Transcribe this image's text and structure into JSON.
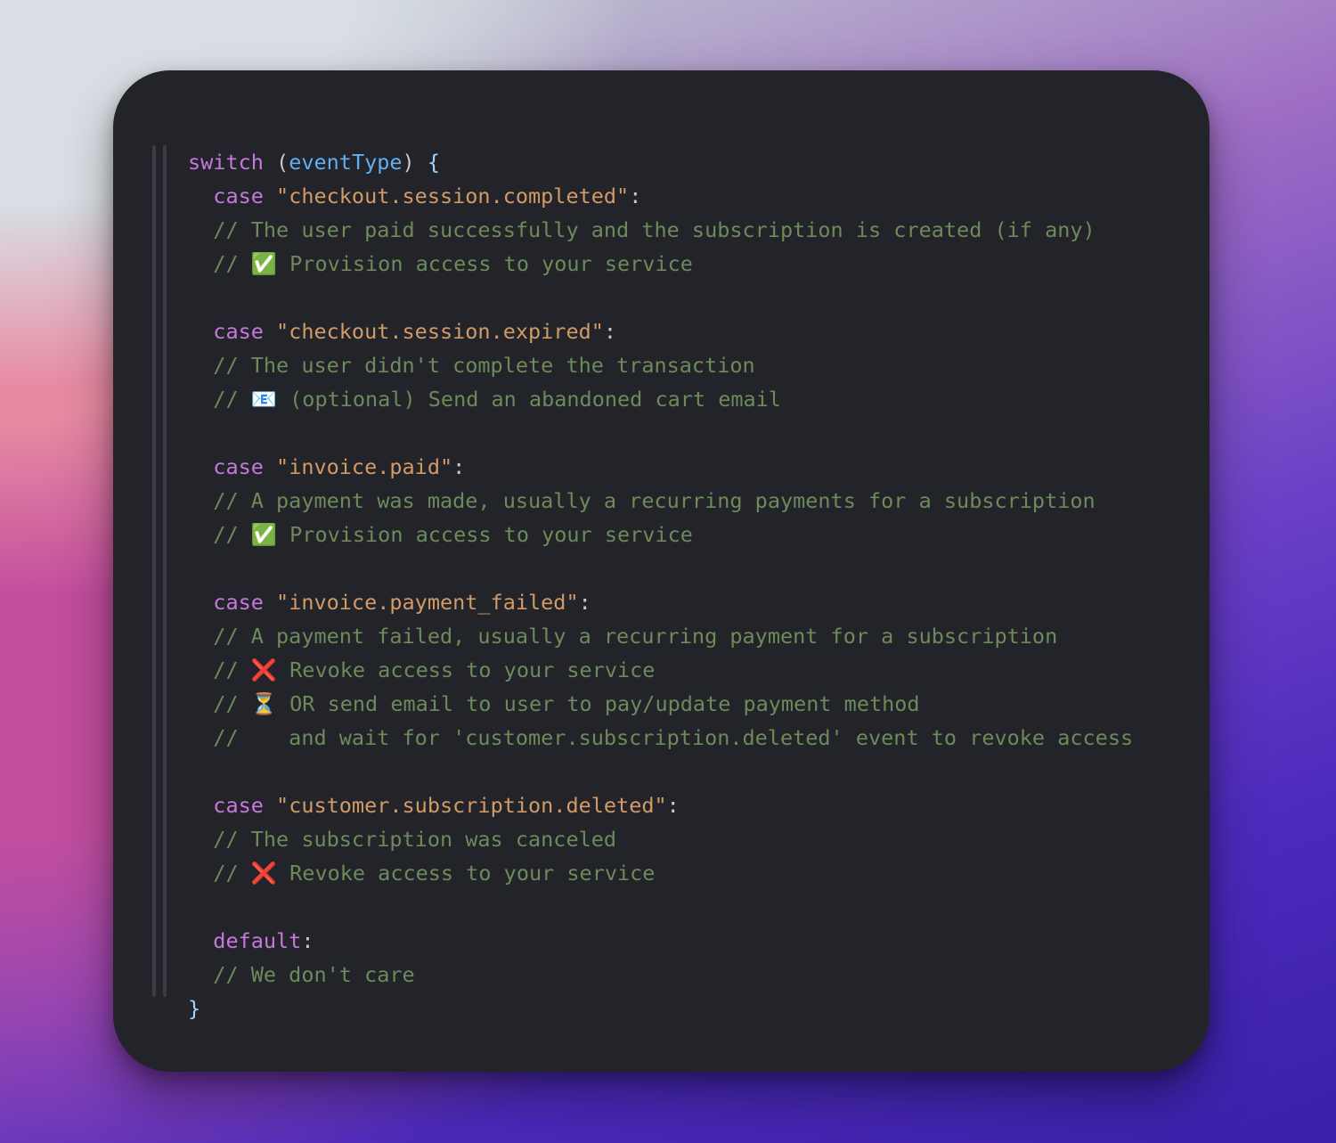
{
  "code": {
    "switchKw": "switch",
    "openParen": "(",
    "varName": "eventType",
    "closeParen": ")",
    "openBrace": "{",
    "closeBrace": "}",
    "caseKw": "case",
    "defaultKw": "default",
    "colon": ":",
    "cases": [
      {
        "value": "\"checkout.session.completed\"",
        "comments": [
          "// The user paid successfully and the subscription is created (if any)",
          "// ✅ Provision access to your service"
        ]
      },
      {
        "value": "\"checkout.session.expired\"",
        "comments": [
          "// The user didn't complete the transaction",
          "// 📧 (optional) Send an abandoned cart email"
        ]
      },
      {
        "value": "\"invoice.paid\"",
        "comments": [
          "// A payment was made, usually a recurring payments for a subscription",
          "// ✅ Provision access to your service"
        ]
      },
      {
        "value": "\"invoice.payment_failed\"",
        "comments": [
          "// A payment failed, usually a recurring payment for a subscription",
          "// ❌ Revoke access to your service",
          "// ⏳ OR send email to user to pay/update payment method",
          "//    and wait for 'customer.subscription.deleted' event to revoke access"
        ]
      },
      {
        "value": "\"customer.subscription.deleted\"",
        "comments": [
          "// The subscription was canceled",
          "// ❌ Revoke access to your service"
        ]
      }
    ],
    "defaultComments": [
      "// We don't care"
    ]
  },
  "colors": {
    "cardBg": "#23232a",
    "keyword": "#c678dd",
    "variable": "#61afef",
    "string": "#d19a66",
    "comment": "#6c8a5a",
    "brace": "#9fd4ff"
  }
}
